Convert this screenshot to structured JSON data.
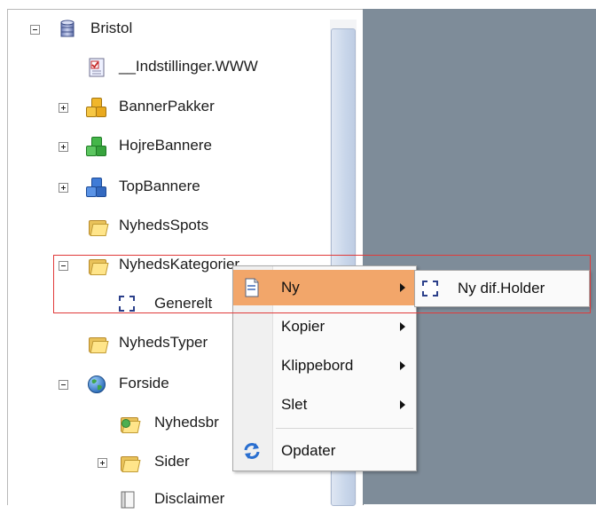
{
  "tree": {
    "root": {
      "label": "Bristol",
      "icon": "database-icon"
    },
    "items": [
      {
        "label": "__Indstillinger.WWW",
        "icon": "settings-document-icon"
      },
      {
        "label": "BannerPakker",
        "icon": "cubes-gold-icon"
      },
      {
        "label": "HojreBannere",
        "icon": "cubes-green-icon"
      },
      {
        "label": "TopBannere",
        "icon": "cubes-blue-icon"
      },
      {
        "label": "NyhedsSpots",
        "icon": "folder-icon"
      },
      {
        "label": "NyhedsKategorier",
        "icon": "folder-open-icon"
      },
      {
        "label": "Generelt",
        "icon": "placeholder-icon"
      },
      {
        "label": "NyhedsTyper",
        "icon": "folder-icon"
      },
      {
        "label": "Forside",
        "icon": "globe-icon"
      },
      {
        "label": "Nyhedsbr",
        "icon": "folder-special-icon"
      },
      {
        "label": "Sider",
        "icon": "folder-icon"
      },
      {
        "label": "Disclaimer",
        "icon": "page-icon"
      }
    ]
  },
  "context_menu": {
    "items": [
      {
        "label": "Ny",
        "icon": "new-document-icon",
        "has_submenu": true,
        "highlighted": true
      },
      {
        "label": "Kopier",
        "has_submenu": true
      },
      {
        "label": "Klippebord",
        "has_submenu": true
      },
      {
        "label": "Slet",
        "has_submenu": true
      },
      {
        "label": "Opdater",
        "icon": "refresh-icon",
        "has_submenu": false
      }
    ]
  },
  "submenu": {
    "items": [
      {
        "label": "Ny dif.Holder",
        "icon": "placeholder-icon"
      }
    ]
  },
  "colors": {
    "right_pane": "#7e8c99",
    "menu_highlight": "#f2a66a",
    "callout_border": "#e03a3a"
  }
}
